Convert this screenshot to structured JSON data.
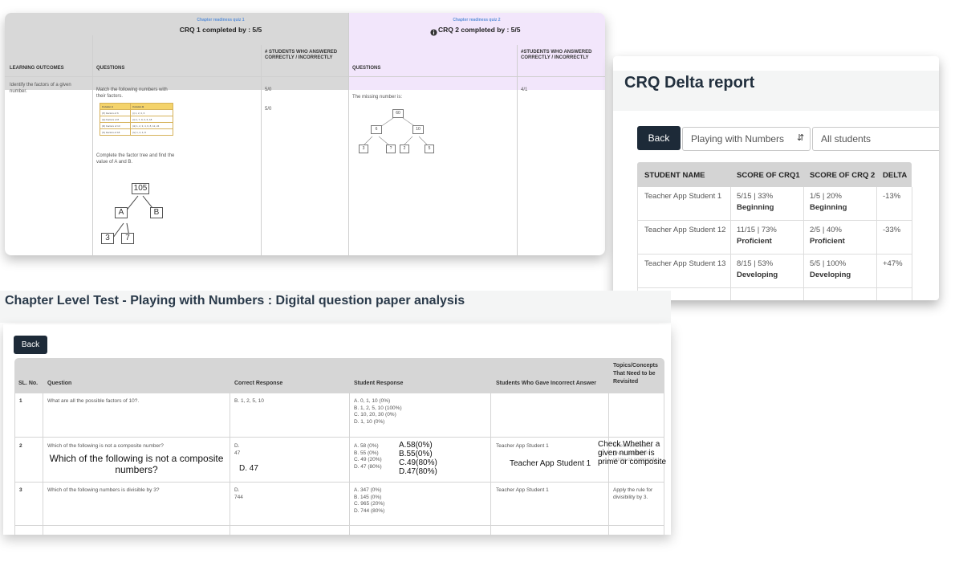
{
  "crq": {
    "quiz1_name": "Chapter readiness quiz 1",
    "quiz1_completed": "CRQ 1 completed by : 5/5",
    "quiz2_name": "Chapter readiness quiz 2",
    "quiz2_completed": "CRQ 2 completed by : 5/5",
    "col_learning_outcomes": "LEARNING OUTCOMES",
    "col_questions": "QUESTIONS",
    "col_students_1": "# STUDENTS WHO ANSWERED CORRECTLY / INCORRECTLY",
    "col_questions_2": "QUESTIONS",
    "col_students_2": "#STUDENTS WHO ANSWERED CORRECTLY / INCORRECTLY",
    "outcome": "Identify the factors of a given number.",
    "q1_text": "Match the following numbers with their factors.",
    "match_table": [
      [
        "Column A",
        "Column B"
      ],
      [
        "(P) Factors of 6",
        "(i) 1, 2, 3, 6"
      ],
      [
        "(Q) Factors of 8",
        "(ii) 1, 7, 9, 3, 6, 18"
      ],
      [
        "(R) Factors of 13",
        "(iii) 1, 2, 3, 4, 6, 8, 12, 24"
      ],
      [
        "(S) Factors of 18",
        "(iv) 1, 2, 4, 8"
      ]
    ],
    "q2_text": "Complete the factor tree and find the value of A and B.",
    "tree": {
      "root": "105",
      "left": "A",
      "right": "B",
      "leaf1": "3",
      "leaf2": "7"
    },
    "result_1a": "5/0",
    "result_1b": "5/0",
    "q3_text": "The missing number is:",
    "small_tree": {
      "root": "60",
      "left": "6",
      "right": "10",
      "l1": "3",
      "l2": "?",
      "l3": "2",
      "l4": "5"
    },
    "result_2": "4/1"
  },
  "delta": {
    "title": "CRQ Delta report",
    "back_label": "Back",
    "chapter_select": "Playing with Numbers",
    "student_select": "All students",
    "headers": [
      "STUDENT NAME",
      "SCORE OF CRQ1",
      "SCORE OF CRQ 2",
      "DELTA"
    ],
    "rows": [
      {
        "name": "Teacher App Student 1",
        "s1": "5/15 | 33%",
        "l1": "Beginning",
        "s2": "1/5 | 20%",
        "l2": "Beginning",
        "delta": "-13%"
      },
      {
        "name": "Teacher App Student 12",
        "s1": "11/15 | 73%",
        "l1": "Proficient",
        "s2": "2/5 | 40%",
        "l2": "Proficient",
        "delta": "-33%"
      },
      {
        "name": "Teacher App Student 13",
        "s1": "8/15 | 53%",
        "l1": "Developing",
        "s2": "5/5 | 100%",
        "l2": "Developing",
        "delta": "+47%"
      }
    ],
    "colors": {
      "negative": "#e6894b",
      "positive": "#3a9d48"
    }
  },
  "analysis": {
    "title": "Chapter Level Test - Playing with Numbers : Digital question paper analysis",
    "back_label": "Back",
    "headers": [
      "SL. No.",
      "Question",
      "Correct Response",
      "Student Response",
      "Students Who Gave Incorrect Answer",
      "Topics/Concepts That Need to be Revisited"
    ],
    "rows": [
      {
        "sl": "1",
        "question": "What are all the possible factors of 10?.",
        "correct": "B. 1, 2, 5, 10",
        "responses": [
          "A. 0, 1, 10 (0%)",
          "B. 1, 2, 5, 10 (100%)",
          "C. 10, 20, 30 (0%)",
          "D. 1, 10 (0%)"
        ],
        "incorrect": "",
        "topics": ""
      },
      {
        "sl": "2",
        "question": "Which of the following is not a composite number?",
        "correct_1": "D.",
        "correct_2": "47",
        "responses": [
          "A. 58 (0%)",
          "B. 55 (0%)",
          "C. 49 (20%)",
          "D. 47 (80%)"
        ],
        "incorrect": "Teacher App Student 1",
        "topics": "Check whether a given number is prime or composite."
      },
      {
        "sl": "3",
        "question": "Which of the following numbers is divisible by 3?",
        "correct_1": "D.",
        "correct_2": "744",
        "responses": [
          "A. 347 (0%)",
          "B. 145 (0%)",
          "C. 965 (20%)",
          "D. 744 (80%)"
        ],
        "incorrect": "Teacher App Student 1",
        "topics": "Apply the rule for divisibility by 3."
      }
    ],
    "overlay": {
      "question": "Which of the following is not a composite numbers?",
      "correct": "D. 47",
      "responses": [
        "A.58(0%)",
        "B.55(0%)",
        "C.49(80%)",
        "D.47(80%)"
      ],
      "incorrect": "Teacher App Student 1",
      "topics": "Check Whether a given number is prime or composite"
    }
  }
}
